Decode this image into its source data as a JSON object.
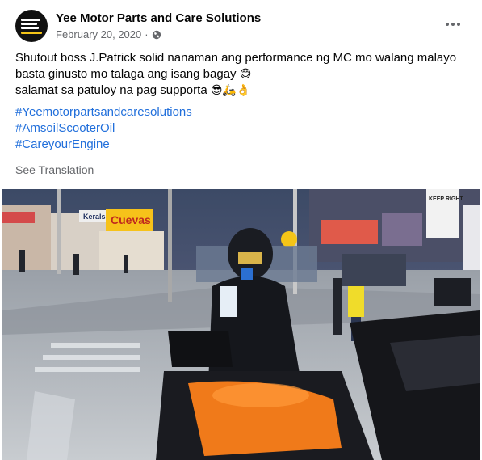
{
  "post": {
    "author": "Yee Motor Parts and Care Solutions",
    "date": "February 20, 2020",
    "separator": "·",
    "privacy_icon": "globe-icon",
    "more_icon": "more-options-icon",
    "text_line_1": "Shutout boss J.Patrick solid nanaman ang performance ng MC mo walang malayo",
    "text_line_2": "basta ginusto mo talaga ang isang bagay",
    "emoji_line_2": "😅",
    "text_line_3": "salamat sa patuloy na pag supporta",
    "emoji_line_3": "😎🛵👌",
    "hashtags": [
      "#Yeemotorpartsandcaresolutions",
      "#AmsoilScooterOil",
      "#CareyourEngine"
    ],
    "see_translation": "See Translation"
  },
  "photo": {
    "signs": {
      "store": "Cuevas",
      "store_small": "Kerals",
      "keep_right": "KEEP RIGHT"
    }
  },
  "colors": {
    "link": "#216fdb",
    "secondary_text": "#65676b",
    "text": "#050505",
    "motorcycle_orange": "#f07a1a",
    "store_sign_yellow": "#f6c21a"
  }
}
